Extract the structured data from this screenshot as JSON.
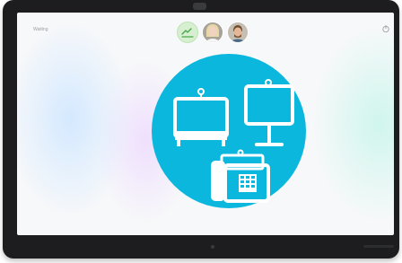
{
  "screen": {
    "status_text": "Waiting"
  },
  "icons": {
    "power": "power-icon",
    "whiteboard": "whiteboard-icon",
    "room_kit": "room-kit-icon",
    "desk_display": "desk-display-icon",
    "ip_phone": "ip-phone-icon"
  },
  "colors": {
    "accent_circle": "#0cb7de",
    "bezel": "#1d1d1f",
    "status_text": "#9aa0a6"
  }
}
